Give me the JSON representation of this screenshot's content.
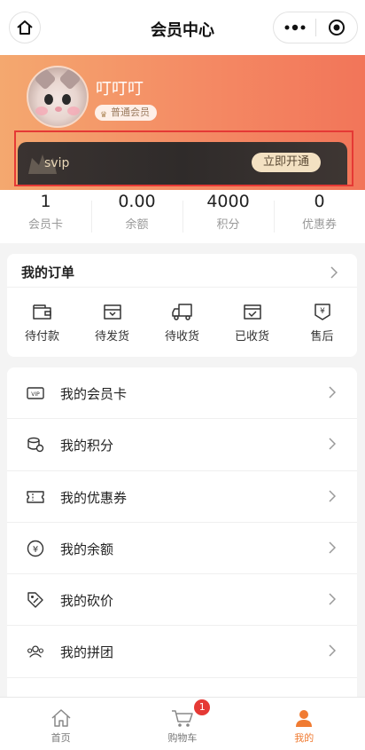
{
  "header": {
    "title": "会员中心"
  },
  "profile": {
    "username": "叮叮叮",
    "level": "普通会员"
  },
  "svip": {
    "label": "svip",
    "button": "立即开通"
  },
  "stats": [
    {
      "value": "1",
      "label": "会员卡"
    },
    {
      "value": "0.00",
      "label": "余额"
    },
    {
      "value": "4000",
      "label": "积分"
    },
    {
      "value": "0",
      "label": "优惠券"
    }
  ],
  "orders": {
    "title": "我的订单",
    "items": [
      {
        "label": "待付款",
        "icon": "wallet-icon"
      },
      {
        "label": "待发货",
        "icon": "package-icon"
      },
      {
        "label": "待收货",
        "icon": "truck-icon"
      },
      {
        "label": "已收货",
        "icon": "received-box-icon"
      },
      {
        "label": "售后",
        "icon": "refund-icon"
      }
    ]
  },
  "menu": [
    {
      "label": "我的会员卡",
      "icon": "vip-card-icon"
    },
    {
      "label": "我的积分",
      "icon": "coins-icon"
    },
    {
      "label": "我的优惠券",
      "icon": "ticket-icon"
    },
    {
      "label": "我的余额",
      "icon": "yen-circle-icon"
    },
    {
      "label": "我的砍价",
      "icon": "price-tag-icon"
    },
    {
      "label": "我的拼团",
      "icon": "group-users-icon"
    }
  ],
  "tabbar": {
    "items": [
      {
        "label": "首页",
        "icon": "home-icon"
      },
      {
        "label": "购物车",
        "icon": "cart-icon",
        "badge": "1"
      },
      {
        "label": "我的",
        "icon": "user-icon"
      }
    ]
  },
  "colors": {
    "accent": "#f07b32",
    "badge": "#e53935",
    "highlight_outline": "#e53935"
  }
}
